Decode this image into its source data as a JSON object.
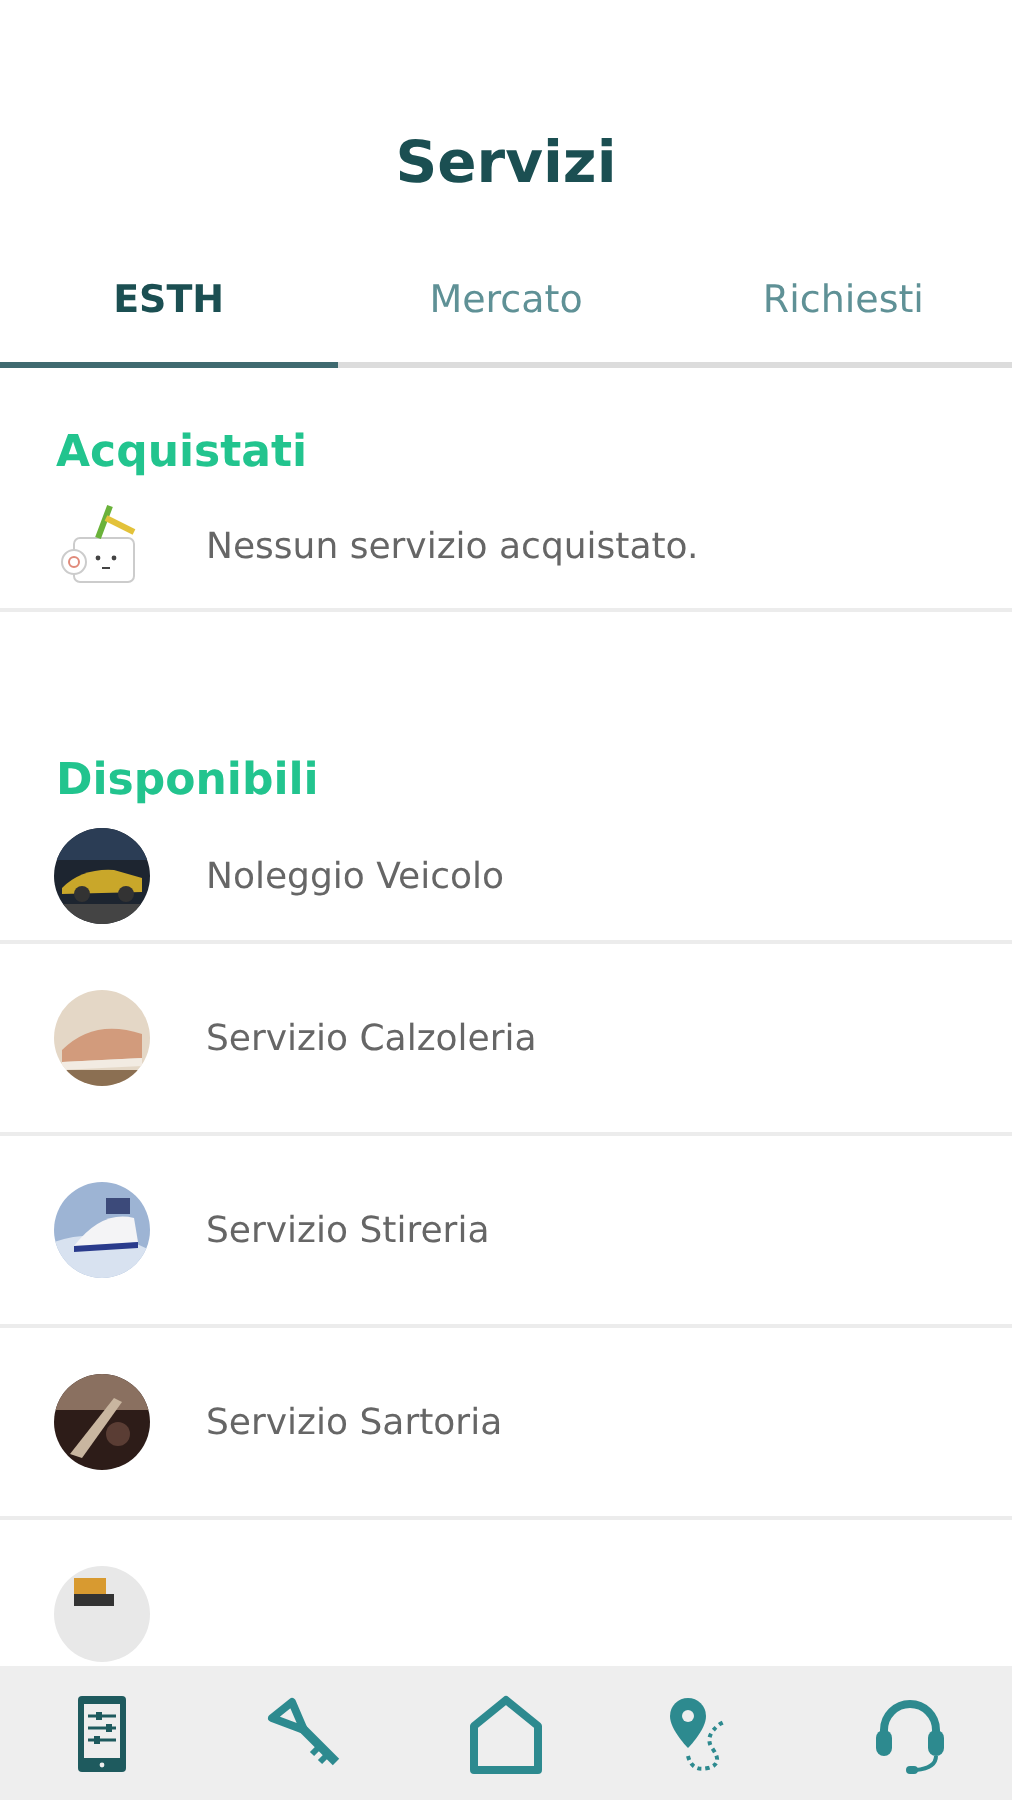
{
  "header": {
    "title": "Servizi"
  },
  "tabs": [
    {
      "label": "ESTH",
      "selected": true
    },
    {
      "label": "Mercato",
      "selected": false
    },
    {
      "label": "Richiesti",
      "selected": false
    }
  ],
  "purchased": {
    "heading": "Acquistati",
    "empty_message": "Nessun servizio acquistato."
  },
  "available": {
    "heading": "Disponibili",
    "items": [
      {
        "name": "Noleggio Veicolo",
        "kind": "car"
      },
      {
        "name": "Servizio Calzoleria",
        "kind": "shoe"
      },
      {
        "name": "Servizio Stireria",
        "kind": "iron"
      },
      {
        "name": "Servizio Sartoria",
        "kind": "sewing"
      },
      {
        "kind": "laundry"
      }
    ]
  },
  "bottom_nav": [
    {
      "kind": "services",
      "selected": true
    },
    {
      "kind": "key",
      "selected": false
    },
    {
      "kind": "home",
      "selected": false
    },
    {
      "kind": "route",
      "selected": false
    },
    {
      "kind": "support",
      "selected": false
    }
  ]
}
